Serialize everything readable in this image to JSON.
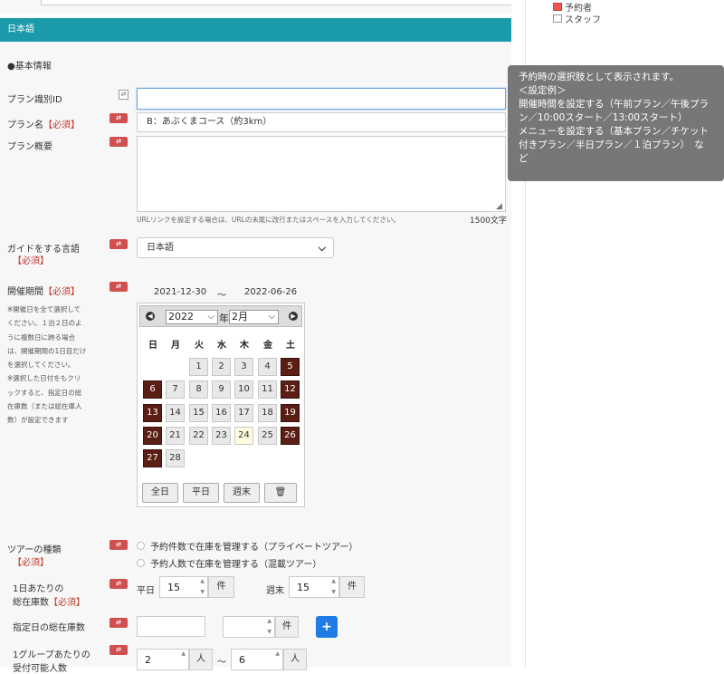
{
  "sidebar_links": [
    {
      "label": "予約者"
    },
    {
      "label": "スタッフ"
    }
  ],
  "section_header": "日本語",
  "basic_info_label": "●基本情報",
  "fields": {
    "plan_id": {
      "label": "プラン識別ID",
      "value": ""
    },
    "plan_name": {
      "label": "プラン名",
      "required": "【必須】",
      "value": "B：あぶくまコース（約3km）"
    },
    "plan_summary": {
      "label": "プラン概要",
      "value": "",
      "hint": "URLリンクを設定する場合は、URLの末尾に改行またはスペースを入力してください。",
      "char_limit": "1500文字"
    },
    "guide_language": {
      "label": "ガイドをする言語",
      "required": "【必須】",
      "selected": "日本語"
    },
    "period": {
      "label": "開催期間",
      "required": "【必須】",
      "start": "2021-12-30",
      "tilde": "～",
      "end": "2022-06-26",
      "note_lines": [
        "※開催日を全て選択して",
        "ください。１泊２日のよ",
        "うに複数日に跨る場合",
        "は、開催期間の1日目だけ",
        "を選択してください。",
        "※選択した日付をもクリ",
        "ックすると、指定日の総",
        "在庫数（または総在庫人",
        "数）が設定できます"
      ]
    },
    "tour_type": {
      "label": "ツアーの種類",
      "required": "【必須】",
      "options": [
        "予約件数で在庫を管理する（プライベートツアー）",
        "予約人数で在庫を管理する（混載ツアー）"
      ]
    },
    "daily_stock": {
      "label_line1": "1日あたりの",
      "label_line2": "総在庫数",
      "required": "【必須】",
      "weekday_label": "平日",
      "weekday_value": "15",
      "weekend_label": "週末",
      "weekend_value": "15",
      "unit": "件"
    },
    "date_stock": {
      "label": "指定日の総在庫数",
      "value": "",
      "count": "",
      "unit": "件",
      "add": "+"
    },
    "group_capacity": {
      "label_line1": "1グループあたりの",
      "label_line2": "受付可能人数",
      "min": "2",
      "max": "6",
      "unit": "人",
      "tilde": "～"
    }
  },
  "calendar": {
    "year": "2022",
    "year_suffix": "年",
    "month": "2月",
    "prev": "◀",
    "next": "▶",
    "weekdays": [
      "日",
      "月",
      "火",
      "水",
      "木",
      "金",
      "土"
    ],
    "weeks": [
      [
        null,
        null,
        1,
        2,
        3,
        4,
        5
      ],
      [
        6,
        7,
        8,
        9,
        10,
        11,
        12
      ],
      [
        13,
        14,
        15,
        16,
        17,
        18,
        19
      ],
      [
        20,
        21,
        22,
        23,
        24,
        25,
        26
      ],
      [
        27,
        28,
        null,
        null,
        null,
        null,
        null
      ]
    ],
    "selected_days": [
      5,
      6,
      12,
      13,
      19,
      20,
      26,
      27
    ],
    "today": 24,
    "buttons": {
      "all": "全日",
      "weekday": "平日",
      "weekend": "週末",
      "clear": "🗑"
    }
  },
  "tooltip_lines": [
    "予約時の選択肢として表示されます。",
    "＜設定例＞",
    "開催時間を設定する（午前プラン／午後プラ",
    "ン／10:00スタート／13:00スタート）",
    "メニューを設定する（基本プラン／チケット",
    "付きプラン／半日プラン／１泊プラン）　な",
    "ど"
  ],
  "colors": {
    "header": "#1a9aaa",
    "selected_day": "#5a1e14",
    "required": "#c0392b",
    "add_button": "#1f7be5",
    "tooltip_bg": "#777777"
  }
}
